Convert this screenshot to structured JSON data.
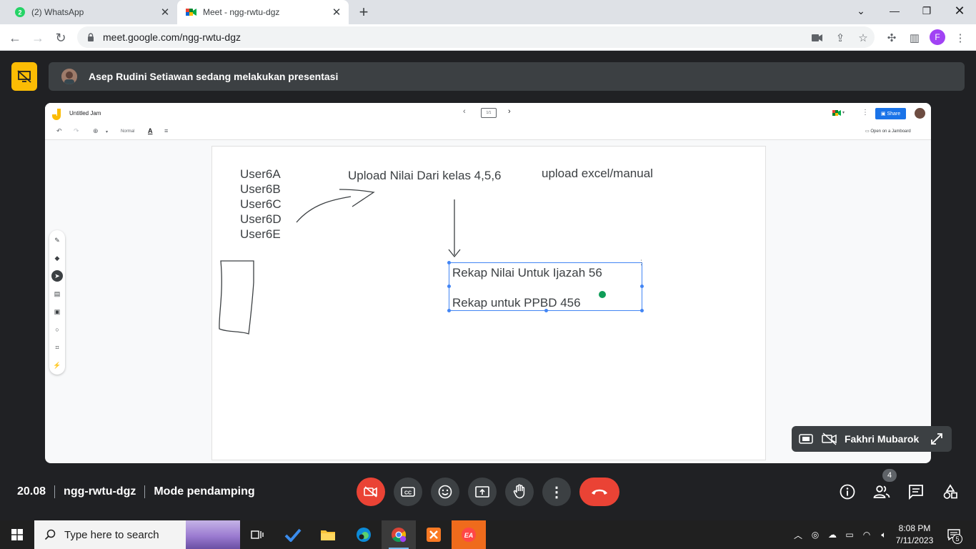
{
  "browser": {
    "tabs": [
      {
        "title": "(2) WhatsApp",
        "badge": "2",
        "active": false
      },
      {
        "title": "Meet - ngg-rwtu-dgz",
        "active": true
      }
    ],
    "url": "meet.google.com/ngg-rwtu-dgz",
    "profile_initial": "F",
    "accent": "#1a73e8"
  },
  "meet": {
    "presenter_banner": "Asep Rudini Setiawan sedang melakukan presentasi",
    "self_name": "Fakhri Mubarok",
    "time": "20.08",
    "meeting_code": "ngg-rwtu-dgz",
    "mode": "Mode pendamping",
    "participants_count": "4",
    "end_call_color": "#ea4335"
  },
  "jamboard": {
    "title": "Untitled Jam",
    "frame_label": "1/1",
    "share_label": "Share",
    "style_label": "Normal",
    "open_label": "Open on a Jamboard",
    "users": [
      "User6A",
      "User6B",
      "User6C",
      "User6D",
      "User6E"
    ],
    "heading_upload": "Upload Nilai Dari kelas 4,5,6",
    "heading_excel": "upload excel/manual",
    "textbox_line1": "Rekap Nilai Untuk Ijazah 56",
    "textbox_line2": "Rekap untuk PPBD 456"
  },
  "taskbar": {
    "search_placeholder": "Type here to search",
    "time": "8:08 PM",
    "date": "7/11/2023",
    "notification_count": "5"
  }
}
